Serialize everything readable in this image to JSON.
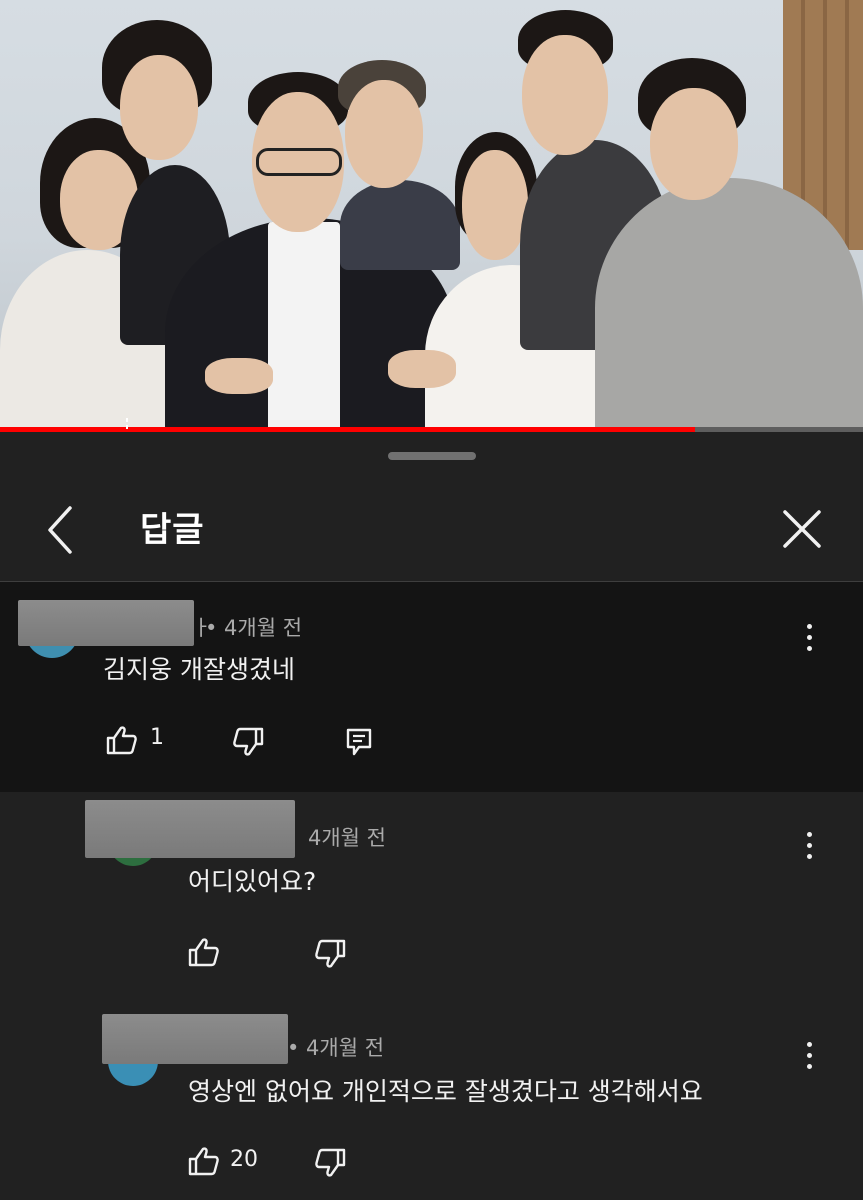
{
  "header": {
    "title": "답글"
  },
  "icons": {
    "back": "chevron-left-icon",
    "close": "close-x-icon",
    "more": "more-vertical-icon",
    "like": "thumbs-up-icon",
    "dislike": "thumbs-down-icon",
    "reply": "reply-icon"
  },
  "colors": {
    "progress": "#ff0000",
    "sheet": "#212121",
    "highlight": "#141414"
  },
  "video": {
    "progress": 0.805
  },
  "comments": [
    {
      "author_suffix": "ㅏ",
      "time": "• 4개월 전",
      "text": "김지웅 개잘생겼네",
      "likes": "1"
    },
    {
      "time": "4개월 전",
      "text": "어디있어요?",
      "likes": ""
    },
    {
      "time": "• 4개월 전",
      "text": "영상엔 없어요  개인적으로 잘생겼다고 생각해서요",
      "likes": "20"
    }
  ]
}
